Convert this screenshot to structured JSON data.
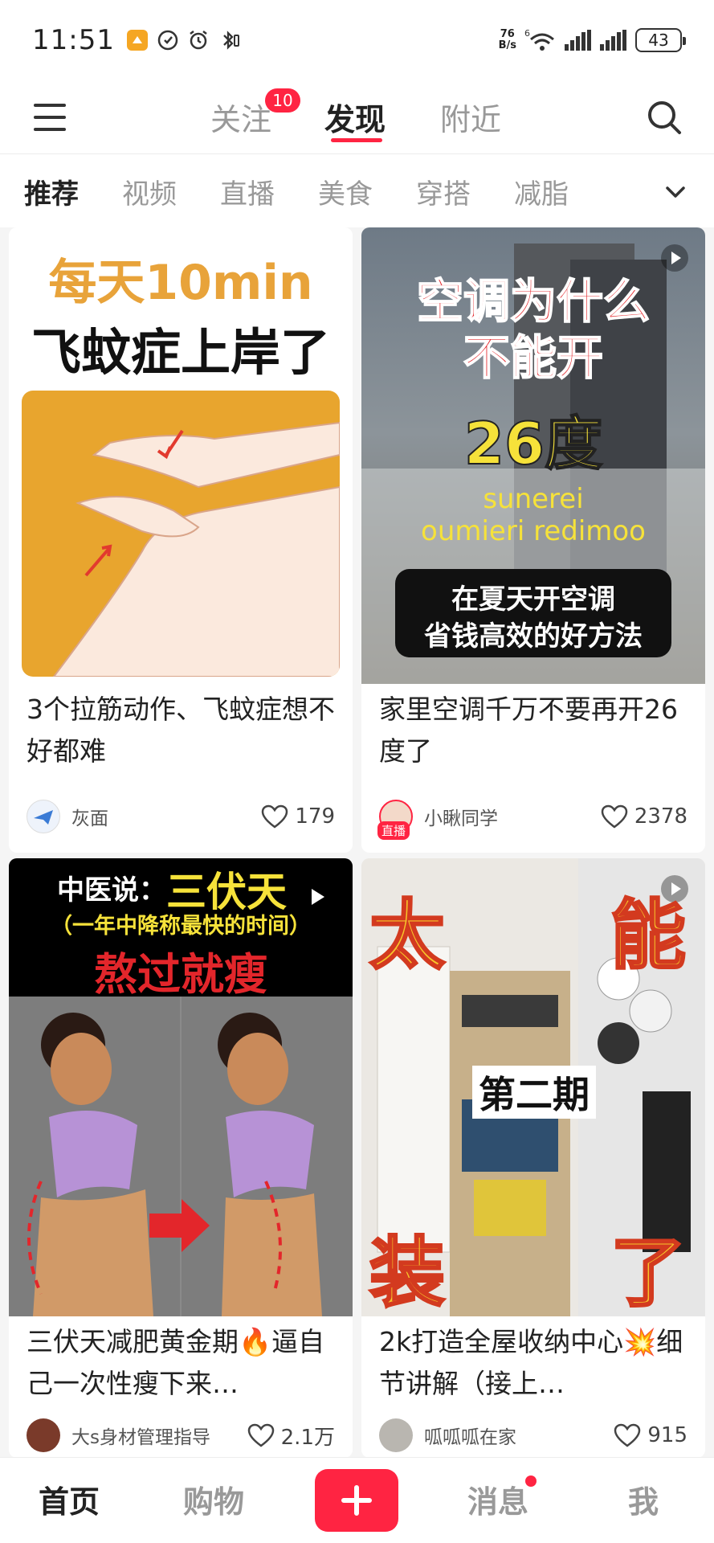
{
  "status_bar": {
    "time": "11:51",
    "net_speed_value": "76",
    "net_speed_unit": "B/s",
    "wifi_label": "6",
    "battery": "43"
  },
  "top_nav": {
    "tabs": [
      {
        "label": "关注",
        "badge": "10"
      },
      {
        "label": "发现"
      },
      {
        "label": "附近"
      }
    ],
    "active_tab": "发现"
  },
  "categories": {
    "items": [
      "推荐",
      "视频",
      "直播",
      "美食",
      "穿搭",
      "减脂"
    ],
    "active": "推荐"
  },
  "feed": {
    "cards": [
      {
        "image_text": [
          "每天10min",
          "飞蚊症上岸了"
        ],
        "title": "3个拉筋动作、飞蚊症想不好都难",
        "author": "灰面",
        "likes": "179"
      },
      {
        "image_text": [
          "空调为什么",
          "不能开",
          "26度",
          "sunerei",
          "oumieri redimoo",
          "在夏天开空调",
          "省钱高效的好方法"
        ],
        "title": "家里空调千万不要再开26度了",
        "author": "小瞅同学",
        "author_tag": "直播",
        "likes": "2378"
      },
      {
        "image_text": [
          "中医说：",
          "三伏天",
          "（一年中降称最快的时间）",
          "熬过就瘦"
        ],
        "title": "三伏天减肥黄金期🔥逼自己一次性瘦下来…",
        "author": "大s身材管理指导",
        "likes": "2.1万"
      },
      {
        "image_text": [
          "太",
          "能",
          "第二期",
          "装",
          "了"
        ],
        "title": "2k打造全屋收纳中心💥细节讲解（接上…",
        "author": "呱呱呱在家",
        "likes": "915"
      }
    ]
  },
  "bottom_nav": {
    "items": [
      "首页",
      "购物",
      "消息",
      "我"
    ],
    "active": "首页"
  },
  "colors": {
    "accent": "#ff2442",
    "text_primary": "#222222",
    "text_secondary": "#999999"
  }
}
